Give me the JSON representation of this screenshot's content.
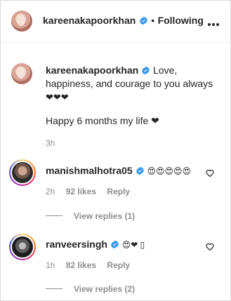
{
  "header": {
    "username": "kareenakapoorkhan",
    "separator": "•",
    "follow_status": "Following"
  },
  "caption": {
    "username": "kareenakapoorkhan",
    "text_inline": "Love,",
    "text_line2": "happiness, and courage to you always",
    "hearts": "❤❤❤",
    "text_line3": "Happy 6 months my life ❤",
    "time": "3h"
  },
  "comments": [
    {
      "username": "manishmalhotra05",
      "text": "😍😍😍😍😍",
      "time": "2h",
      "likes": "92 likes",
      "reply": "Reply",
      "view_replies": "View replies (1)"
    },
    {
      "username": "ranveersingh",
      "text": "😍❤ ▯",
      "time": "1h",
      "likes": "82 likes",
      "reply": "Reply",
      "view_replies": "View replies (2)"
    }
  ],
  "icons": {
    "verified": "verified-badge-icon",
    "more": "more-options-icon",
    "like": "heart-outline-icon"
  },
  "colors": {
    "verified": "#3897f0",
    "text": "#262626",
    "secondary": "#8e8e8e"
  }
}
